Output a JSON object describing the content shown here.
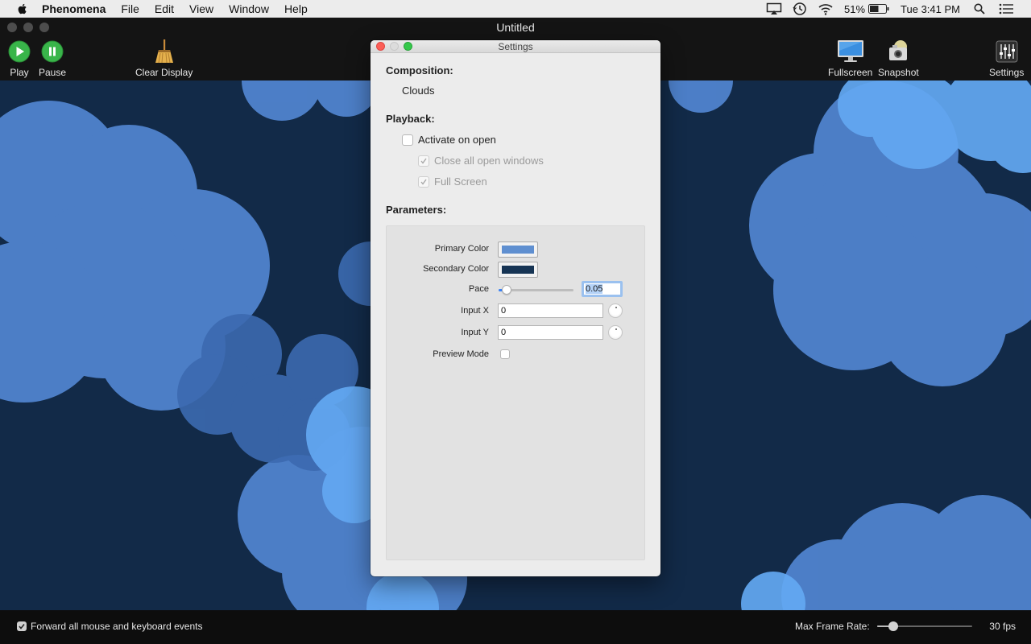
{
  "menubar": {
    "app_name": "Phenomena",
    "items": [
      "File",
      "Edit",
      "View",
      "Window",
      "Help"
    ],
    "battery": "51%",
    "clock": "Tue 3:41 PM"
  },
  "window": {
    "title": "Untitled",
    "toolbar": {
      "play": "Play",
      "pause": "Pause",
      "clear_display": "Clear Display",
      "fullscreen": "Fullscreen",
      "snapshot": "Snapshot",
      "settings": "Settings"
    }
  },
  "bottombar": {
    "forward_events_label": "Forward all mouse and keyboard events",
    "forward_events_checked": true,
    "max_frame_rate_label": "Max Frame Rate:",
    "max_frame_rate_value": "30 fps",
    "max_frame_rate_fraction": 0.13
  },
  "settings_panel": {
    "title": "Settings",
    "composition_heading": "Composition:",
    "composition_value": "Clouds",
    "playback_heading": "Playback:",
    "activate_on_open": "Activate on open",
    "close_all_windows": "Close all open windows",
    "full_screen": "Full Screen",
    "parameters_heading": "Parameters:",
    "params": {
      "primary_color_label": "Primary Color",
      "primary_color": "#5f8fd0",
      "secondary_color_label": "Secondary Color",
      "secondary_color": "#163454",
      "pace_label": "Pace",
      "pace_value": "0.05",
      "pace_fraction": 0.05,
      "input_x_label": "Input X",
      "input_x_value": "0",
      "input_y_label": "Input Y",
      "input_y_value": "0",
      "preview_mode_label": "Preview Mode"
    }
  },
  "colors": {
    "background": "#122a48",
    "cloud_mid": "#4f82cc",
    "cloud_light": "#63a8f2",
    "cloud_dark": "#3c6ab0"
  }
}
